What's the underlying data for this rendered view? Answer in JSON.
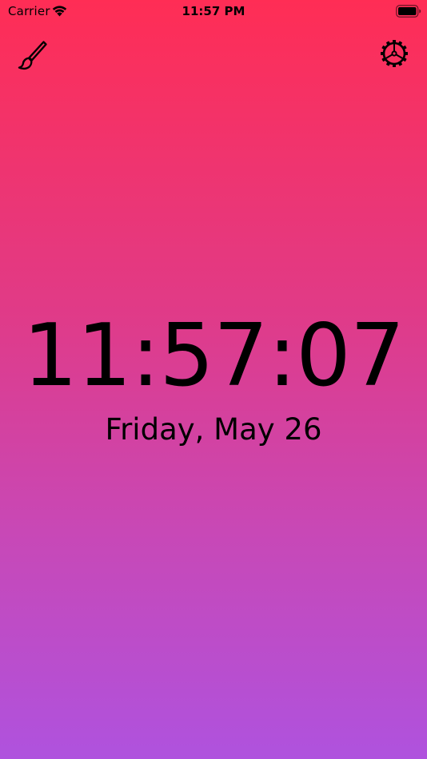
{
  "status_bar": {
    "carrier": "Carrier",
    "time": "11:57 PM",
    "wifi_icon": "wifi-icon",
    "battery_icon": "battery-full-icon"
  },
  "toolbar": {
    "theme_icon": "paintbrush-icon",
    "settings_icon": "gear-icon"
  },
  "clock": {
    "time": "11:57:07",
    "date": "Friday, May 26"
  },
  "colors": {
    "gradient_top": "#ff2d55",
    "gradient_bottom": "#af52de",
    "text": "#000000"
  }
}
